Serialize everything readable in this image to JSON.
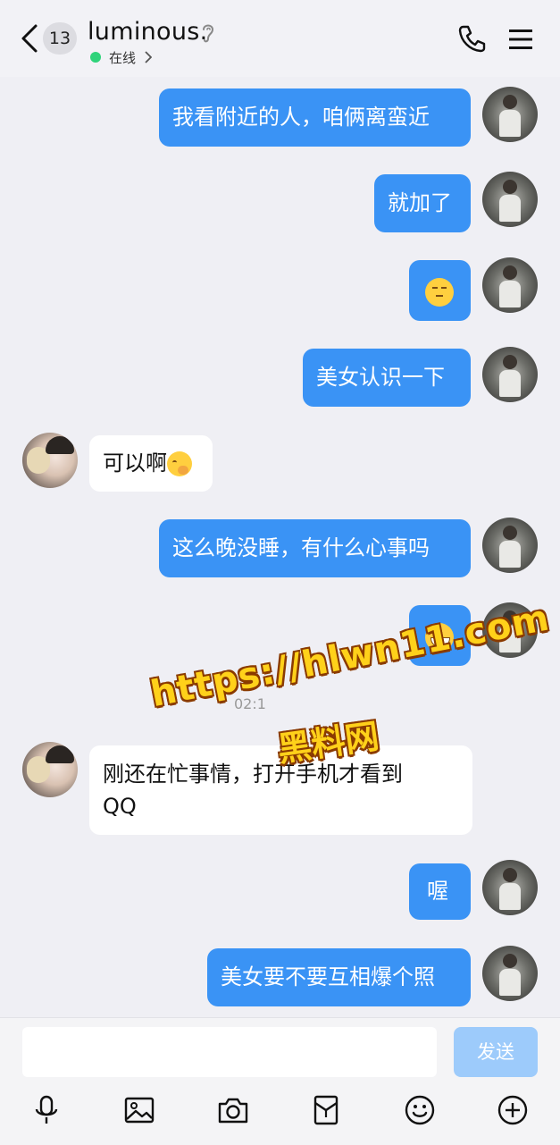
{
  "header": {
    "unread_count": "13",
    "contact_name": "luminous.",
    "status_text": "在线",
    "status_color": "#2fd37a"
  },
  "messages": [
    {
      "side": "out",
      "text": "我看附近的人，咱俩离蛮近"
    },
    {
      "side": "out",
      "text": "就加了"
    },
    {
      "side": "out",
      "emoji": "smirk-face-emoji"
    },
    {
      "side": "out",
      "text": "美女认识一下"
    },
    {
      "side": "in",
      "text": "可以啊",
      "emoji": "thinking-face-emoji"
    },
    {
      "side": "out",
      "text": "这么晚没睡，有什么心事吗"
    },
    {
      "side": "out",
      "emoji": "grinning-face-emoji"
    },
    {
      "side": "in",
      "text_line1": "刚还在忙事情，打开手机才看到",
      "text_line2": "QQ"
    },
    {
      "side": "out",
      "text": "喔"
    },
    {
      "side": "out",
      "text": "美女要不要互相爆个照"
    }
  ],
  "timestamp": "02:1",
  "watermark": {
    "url": "https://hlwn11.com",
    "name": "黑料网"
  },
  "composer": {
    "placeholder": "",
    "send_label": "发送"
  },
  "toolbar_icons": [
    "microphone-icon",
    "image-icon",
    "camera-icon",
    "red-packet-icon",
    "emoji-icon",
    "plus-icon"
  ],
  "colors": {
    "outgoing_bubble": "#3a93f5",
    "incoming_bubble": "#ffffff",
    "send_button": "#9dcbfb",
    "background": "#efeff4"
  }
}
